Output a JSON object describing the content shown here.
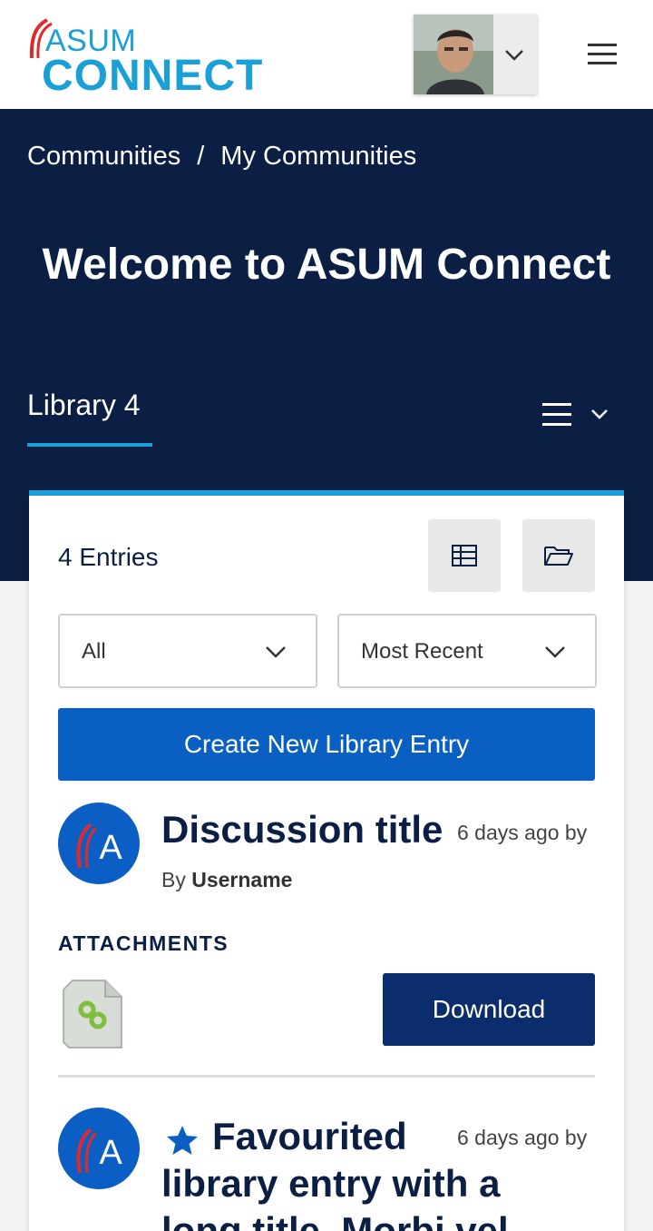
{
  "header": {
    "logo_top": "ASUM",
    "logo_bottom": "CONNECT"
  },
  "hero": {
    "breadcrumb": [
      "Communities",
      "/",
      "My Communities"
    ],
    "title": "Welcome to ASUM Connect",
    "tab_label": "Library 4"
  },
  "library": {
    "entries_count": "4 Entries",
    "filter_select": "All",
    "sort_select": "Most Recent",
    "create_label": "Create New Library Entry"
  },
  "entry1": {
    "avatar_letter": "A",
    "title": "Discussion title",
    "meta": "6 days ago by",
    "by_prefix": "By",
    "username": "Username",
    "attachments_label": "ATTACHMENTS",
    "download_label": "Download"
  },
  "entry2": {
    "avatar_letter": "A",
    "title_line1": "Favourited",
    "title_rest": "library entry with a long title. Morbi vel",
    "meta": "6 days ago by"
  },
  "icons": {
    "table_view": "table-view-icon",
    "folder_view": "folder-icon",
    "star": "star-icon",
    "file": "link-file-icon"
  },
  "colors": {
    "navy": "#0b1f45",
    "accent": "#1aa0d8",
    "primary_button": "#0a60c2",
    "download_button": "#0b2d6b"
  }
}
